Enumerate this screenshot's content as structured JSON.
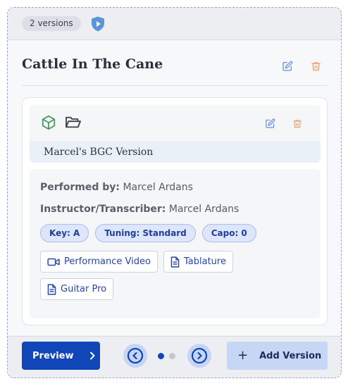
{
  "header": {
    "versions_badge": "2 versions"
  },
  "song": {
    "title": "Cattle In The Cane"
  },
  "version": {
    "name": "Marcel's BGC Version",
    "performed_by_label": "Performed by:",
    "performed_by": "Marcel Ardans",
    "instructor_label": "Instructor/Transcriber:",
    "instructor": "Marcel Ardans",
    "chips": [
      "Key: A",
      "Tuning: Standard",
      "Capo: 0"
    ],
    "resources": {
      "video": "Performance Video",
      "tab": "Tablature",
      "guitar_pro": "Guitar Pro"
    }
  },
  "footer": {
    "preview_label": "Preview",
    "add_version_label": "Add Version",
    "pagination": {
      "current": 1,
      "total": 2
    }
  },
  "colors": {
    "primary": "#1046b8",
    "edit_icon": "#6a8fd6",
    "delete_icon": "#f0a070",
    "cube_icon": "#4a9a62",
    "chip_bg": "#dde6fa"
  }
}
